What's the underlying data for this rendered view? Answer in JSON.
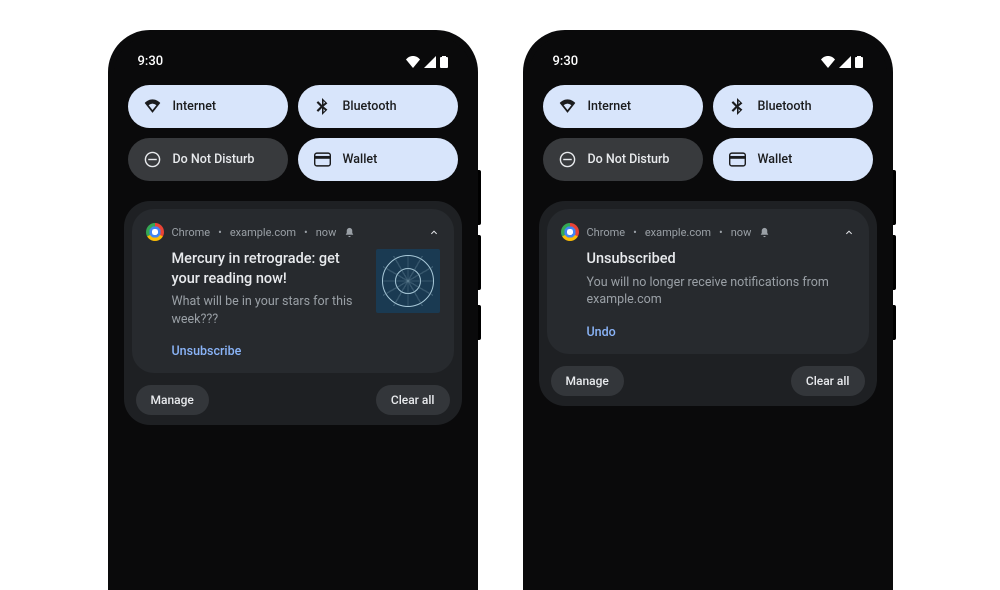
{
  "status": {
    "time": "9:30"
  },
  "tiles": {
    "internet": "Internet",
    "bluetooth": "Bluetooth",
    "dnd": "Do Not Disturb",
    "wallet": "Wallet"
  },
  "notif": {
    "app": "Chrome",
    "source": "example.com",
    "when": "now",
    "left": {
      "title": "Mercury in retrograde: get your reading now!",
      "body": "What will be in your stars for this week???",
      "action": "Unsubscribe"
    },
    "right": {
      "title": "Unsubscribed",
      "body": "You will no longer receive notifications from example.com",
      "action": "Undo"
    }
  },
  "footer": {
    "manage": "Manage",
    "clear": "Clear all"
  }
}
